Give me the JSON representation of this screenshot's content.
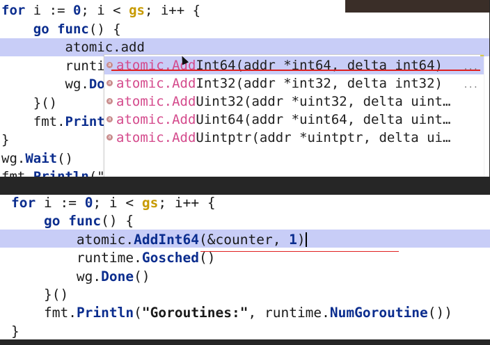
{
  "top": {
    "lines": [
      {
        "indent": "",
        "parts": [
          [
            "kw",
            "for"
          ],
          [
            "t",
            " i := "
          ],
          [
            "num",
            "0"
          ],
          [
            "t",
            "; i < "
          ],
          [
            "gs",
            "gs"
          ],
          [
            "t",
            "; i++ {"
          ]
        ]
      },
      {
        "indent": "    ",
        "parts": [
          [
            "kw",
            "go"
          ],
          [
            "t",
            " "
          ],
          [
            "kw",
            "func"
          ],
          [
            "t",
            "() {"
          ]
        ]
      },
      {
        "indent": "        ",
        "parts": [
          [
            "t",
            "atomic.add"
          ]
        ]
      },
      {
        "indent": "        ",
        "parts": [
          [
            "t",
            "runti"
          ]
        ]
      },
      {
        "indent": "        ",
        "parts": [
          [
            "t",
            "wg."
          ],
          [
            "fn",
            "Do"
          ]
        ]
      },
      {
        "indent": "    ",
        "parts": [
          [
            "t",
            "}()"
          ]
        ]
      },
      {
        "indent": "    ",
        "parts": [
          [
            "t",
            "fmt."
          ],
          [
            "fn",
            "Print"
          ]
        ]
      },
      {
        "indent": "",
        "parts": [
          [
            "t",
            "}"
          ]
        ]
      },
      {
        "indent": "",
        "parts": [
          [
            "t",
            "wg."
          ],
          [
            "fn",
            "Wait"
          ],
          [
            "t",
            "()"
          ]
        ]
      },
      {
        "indent": "",
        "parts": [
          [
            "t",
            "fmt."
          ],
          [
            "fn",
            "Println"
          ],
          [
            "t",
            "(\""
          ]
        ]
      }
    ],
    "autocomplete": {
      "items": [
        {
          "match": "atomic.Add",
          "rest": "Int64(addr *int64, delta int64)",
          "more": "..."
        },
        {
          "match": "atomic.Add",
          "rest": "Int32(addr *int32, delta int32)",
          "more": "..."
        },
        {
          "match": "atomic.Add",
          "rest": "Uint32(addr *uint32, delta uint…",
          "more": ""
        },
        {
          "match": "atomic.Add",
          "rest": "Uint64(addr *uint64, delta uint…",
          "more": ""
        },
        {
          "match": "atomic.Add",
          "rest": "Uintptr(addr *uintptr, delta ui…",
          "more": ""
        }
      ],
      "selected_index": 0,
      "icon_glyph": "a"
    }
  },
  "bottom": {
    "lines": [
      {
        "indent": "",
        "parts": [
          [
            "kw",
            "for"
          ],
          [
            "t",
            " i := "
          ],
          [
            "num",
            "0"
          ],
          [
            "t",
            "; i < "
          ],
          [
            "gs",
            "gs"
          ],
          [
            "t",
            "; i++ {"
          ]
        ]
      },
      {
        "indent": "    ",
        "parts": [
          [
            "kw",
            "go"
          ],
          [
            "t",
            " "
          ],
          [
            "kw",
            "func"
          ],
          [
            "t",
            "() {"
          ]
        ]
      },
      {
        "indent": "        ",
        "parts": [
          [
            "t",
            "atomic."
          ],
          [
            "fn",
            "AddInt64"
          ],
          [
            "t",
            "(&counter, "
          ],
          [
            "num",
            "1"
          ],
          [
            "t",
            ")"
          ],
          [
            "caret",
            ""
          ]
        ]
      },
      {
        "indent": "        ",
        "parts": [
          [
            "t",
            "runtime."
          ],
          [
            "fn",
            "Gosched"
          ],
          [
            "t",
            "()"
          ]
        ]
      },
      {
        "indent": "        ",
        "parts": [
          [
            "t",
            "wg."
          ],
          [
            "fn",
            "Done"
          ],
          [
            "t",
            "()"
          ]
        ]
      },
      {
        "indent": "    ",
        "parts": [
          [
            "t",
            "}()"
          ]
        ]
      },
      {
        "indent": "    ",
        "parts": [
          [
            "t",
            "fmt."
          ],
          [
            "fn",
            "Println"
          ],
          [
            "t",
            "("
          ],
          [
            "str",
            "\"Goroutines:\""
          ],
          [
            "t",
            ", runtime."
          ],
          [
            "fn",
            "NumGoroutine"
          ],
          [
            "t",
            "())"
          ]
        ]
      },
      {
        "indent": "",
        "parts": [
          [
            "t",
            "}"
          ]
        ]
      }
    ]
  },
  "colors": {
    "keyword": "#0b2d8e",
    "match": "#d44a8c",
    "highlight": "#c8cdf7",
    "underline": "#e02020"
  }
}
